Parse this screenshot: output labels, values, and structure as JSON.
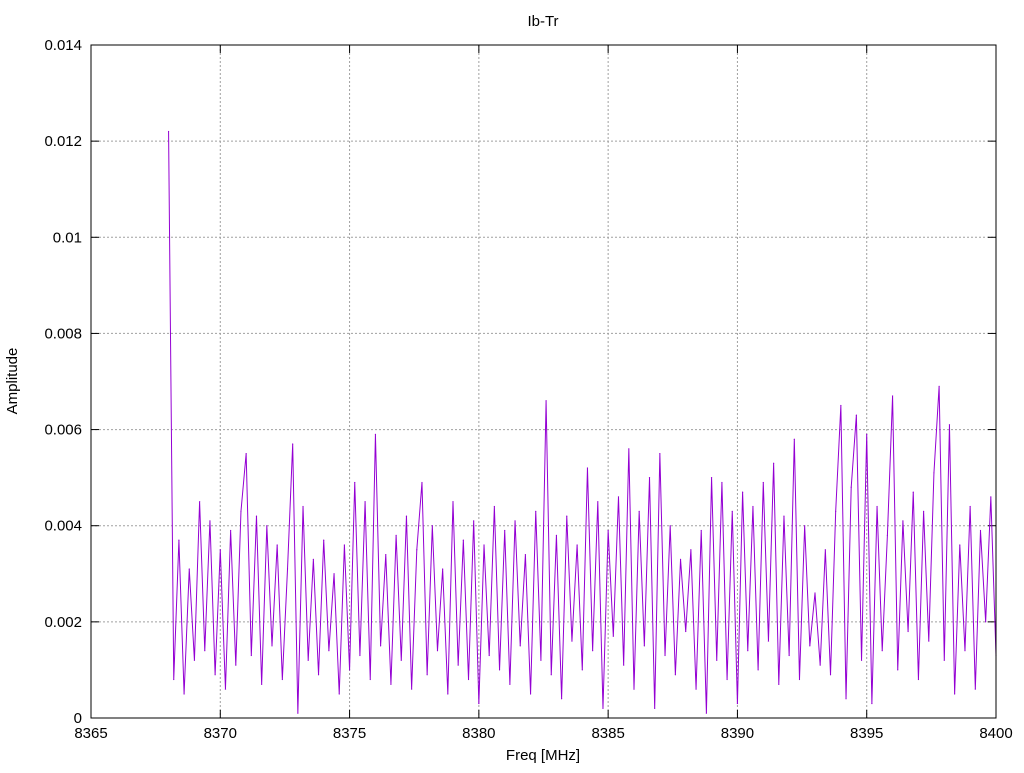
{
  "chart_data": {
    "type": "line",
    "title": "Ib-Tr",
    "xlabel": "Freq [MHz]",
    "ylabel": "Amplitude",
    "xlim": [
      8365,
      8400
    ],
    "ylim": [
      0,
      0.014
    ],
    "grid": true,
    "legend": "none",
    "xticks": [
      "8365",
      "8370",
      "8375",
      "8380",
      "8385",
      "8390",
      "8395",
      "8400"
    ],
    "yticks": [
      "0",
      "0.002",
      "0.004",
      "0.006",
      "0.008",
      "0.01",
      "0.012",
      "0.014"
    ],
    "series": [
      {
        "name": "Ib-Tr",
        "color": "#9400d3",
        "x_start": 8368.0,
        "x_step": 0.2,
        "values": [
          0.0122,
          0.0008,
          0.0037,
          0.0005,
          0.0031,
          0.0012,
          0.0045,
          0.0014,
          0.0041,
          0.0009,
          0.0035,
          0.0006,
          0.0039,
          0.0011,
          0.0043,
          0.0055,
          0.0013,
          0.0042,
          0.0007,
          0.004,
          0.0015,
          0.0036,
          0.0008,
          0.0031,
          0.0057,
          0.0001,
          0.0044,
          0.0012,
          0.0033,
          0.0009,
          0.0037,
          0.0014,
          0.003,
          0.0005,
          0.0036,
          0.001,
          0.0049,
          0.0013,
          0.0045,
          0.0008,
          0.0059,
          0.0015,
          0.0034,
          0.0007,
          0.0038,
          0.0012,
          0.0042,
          0.0006,
          0.0035,
          0.0049,
          0.0009,
          0.004,
          0.0014,
          0.0031,
          0.0005,
          0.0045,
          0.0011,
          0.0037,
          0.0008,
          0.0041,
          0.0003,
          0.0036,
          0.0013,
          0.0044,
          0.001,
          0.0039,
          0.0007,
          0.0041,
          0.0015,
          0.0034,
          0.0005,
          0.0043,
          0.0012,
          0.0066,
          0.0009,
          0.0038,
          0.0004,
          0.0042,
          0.0016,
          0.0036,
          0.001,
          0.0052,
          0.0014,
          0.0045,
          0.0002,
          0.0039,
          0.0017,
          0.0046,
          0.0011,
          0.0056,
          0.0006,
          0.0043,
          0.0015,
          0.005,
          0.0002,
          0.0055,
          0.0013,
          0.004,
          0.0009,
          0.0033,
          0.0018,
          0.0035,
          0.0006,
          0.0039,
          0.0001,
          0.005,
          0.0012,
          0.0049,
          0.0008,
          0.0043,
          0.0003,
          0.0047,
          0.0014,
          0.0044,
          0.001,
          0.0049,
          0.0016,
          0.0053,
          0.0007,
          0.0042,
          0.0013,
          0.0058,
          0.0008,
          0.004,
          0.0015,
          0.0026,
          0.0011,
          0.0035,
          0.0009,
          0.0043,
          0.0065,
          0.0004,
          0.0048,
          0.0063,
          0.0012,
          0.0059,
          0.0003,
          0.0044,
          0.0014,
          0.0038,
          0.0067,
          0.001,
          0.0041,
          0.0018,
          0.0047,
          0.0008,
          0.0043,
          0.0016,
          0.0051,
          0.0069,
          0.0012,
          0.0061,
          0.0005,
          0.0036,
          0.0014,
          0.0044,
          0.0006,
          0.0039,
          0.002,
          0.0046,
          0.0013
        ]
      }
    ]
  }
}
